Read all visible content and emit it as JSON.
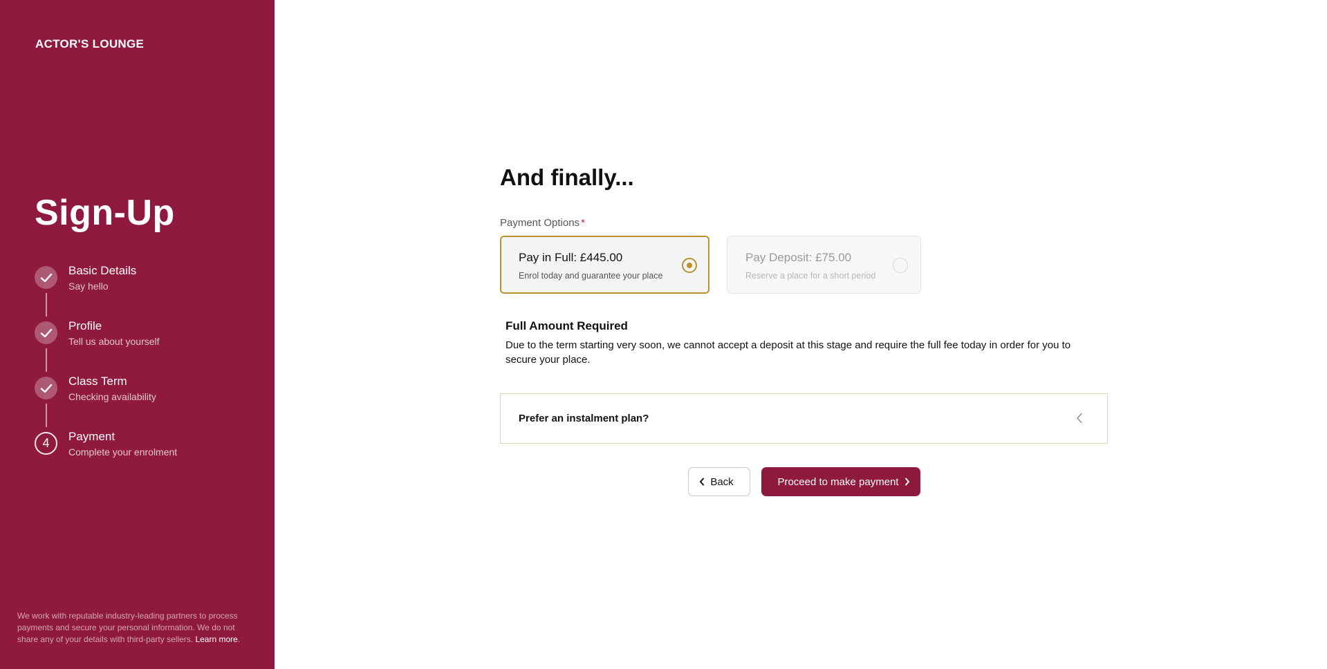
{
  "sidebar": {
    "brand": "ACTOR'S LOUNGE",
    "title": "Sign-Up",
    "steps": [
      {
        "title": "Basic Details",
        "subtitle": "Say hello",
        "status": "done"
      },
      {
        "title": "Profile",
        "subtitle": "Tell us about yourself",
        "status": "done"
      },
      {
        "title": "Class Term",
        "subtitle": "Checking availability",
        "status": "done"
      },
      {
        "number": "4",
        "title": "Payment",
        "subtitle": "Complete your enrolment",
        "status": "current"
      }
    ],
    "footer_text": "We work with reputable industry-leading partners to process payments and secure your personal information. We do not share any of your details with third-party sellers.",
    "footer_link": "Learn more",
    "footer_end": "."
  },
  "main": {
    "heading": "And finally...",
    "payment_label": "Payment Options",
    "required_mark": "*",
    "options": [
      {
        "title": "Pay in Full: £445.00",
        "subtitle": "Enrol today and guarantee your place",
        "selected": true,
        "disabled": false
      },
      {
        "title": "Pay Deposit: £75.00",
        "subtitle": "Reserve a place for a short period",
        "selected": false,
        "disabled": true
      }
    ],
    "notice_title": "Full Amount Required",
    "notice_body": "Due to the term starting very soon, we cannot accept a deposit at this stage and require the full fee today in order for you to secure your place.",
    "instalment_label": "Prefer an instalment plan?",
    "back_label": "Back",
    "proceed_label": "Proceed to make payment"
  },
  "colors": {
    "brand": "#8f1a3d",
    "accent": "#b8922a"
  },
  "icons": [
    "check-icon",
    "chevron-left-icon",
    "chevron-right-icon"
  ]
}
